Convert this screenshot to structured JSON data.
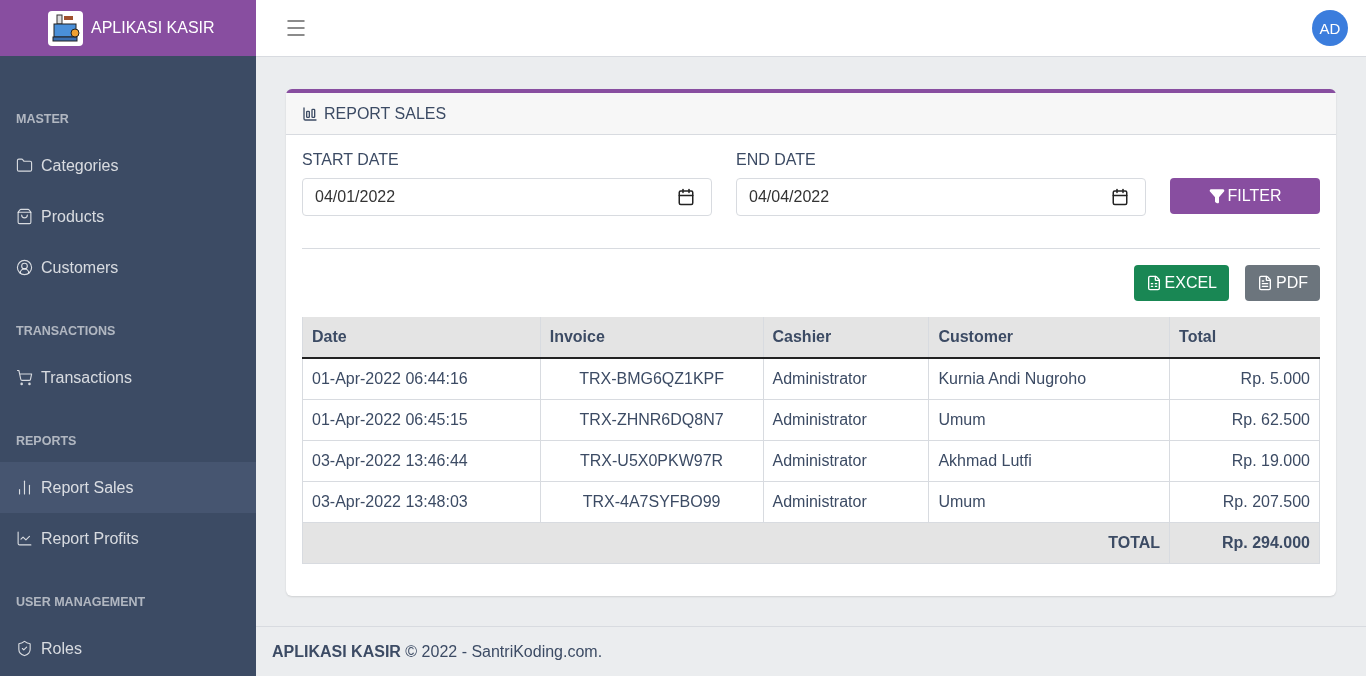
{
  "brand": {
    "title": "APLIKASI KASIR"
  },
  "topbar": {
    "avatar": "AD"
  },
  "sidebar": {
    "sections": [
      {
        "title": "MASTER",
        "items": [
          {
            "label": "Categories",
            "selected": false
          },
          {
            "label": "Products",
            "selected": false
          },
          {
            "label": "Customers",
            "selected": false
          }
        ]
      },
      {
        "title": "TRANSACTIONS",
        "items": [
          {
            "label": "Transactions",
            "selected": false
          }
        ]
      },
      {
        "title": "REPORTS",
        "items": [
          {
            "label": "Report Sales",
            "selected": true
          },
          {
            "label": "Report Profits",
            "selected": false
          }
        ]
      },
      {
        "title": "USER MANAGEMENT",
        "items": [
          {
            "label": "Roles",
            "selected": false
          }
        ]
      }
    ]
  },
  "card": {
    "title": "REPORT SALES",
    "filters": [
      {
        "label": "START DATE",
        "value": "04/01/2022"
      },
      {
        "label": "END DATE",
        "value": "04/04/2022"
      }
    ],
    "filter_button": "FILTER",
    "export_buttons": [
      {
        "kind": "excel",
        "label": "EXCEL"
      },
      {
        "kind": "pdf",
        "label": "PDF"
      }
    ],
    "table": {
      "columns": [
        "Date",
        "Invoice",
        "Cashier",
        "Customer",
        "Total"
      ],
      "rows": [
        [
          "01-Apr-2022 06:44:16",
          "TRX-BMG6QZ1KPF",
          "Administrator",
          "Kurnia Andi Nugroho",
          "Rp. 5.000"
        ],
        [
          "01-Apr-2022 06:45:15",
          "TRX-ZHNR6DQ8N7",
          "Administrator",
          "Umum",
          "Rp. 62.500"
        ],
        [
          "03-Apr-2022 13:46:44",
          "TRX-U5X0PKW97R",
          "Administrator",
          "Akhmad Lutfi",
          "Rp. 19.000"
        ],
        [
          "03-Apr-2022 13:48:03",
          "TRX-4A7SYFBO99",
          "Administrator",
          "Umum",
          "Rp. 207.500"
        ]
      ],
      "total_label": "TOTAL",
      "total_value": "Rp. 294.000"
    }
  },
  "footer": "**APLIKASI KASIR** © 2022 - SantriKoding.com."
}
